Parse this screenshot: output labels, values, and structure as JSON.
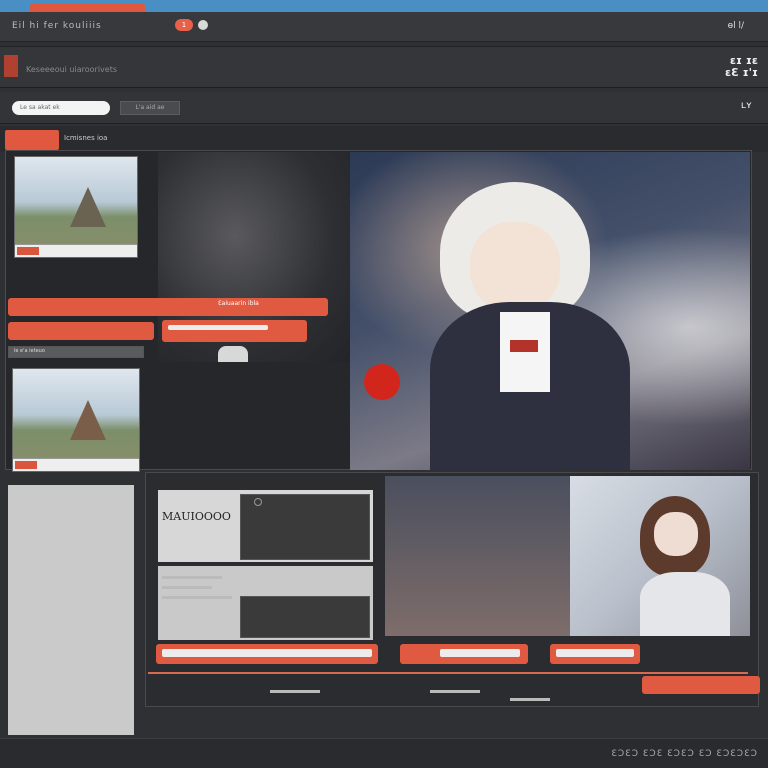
{
  "header": {
    "tab_title": "Eil hi fer kouliiis",
    "notification_count": "1",
    "top_right": "ɵl l/"
  },
  "subheader": {
    "subtitle": "Keseeeoui uiaroorivets",
    "right_label": "ɛɪ ɪɛ\nɛƐ ɪ'ɪ"
  },
  "toolbar": {
    "search_placeholder": "Le sa akat ek",
    "button_label": "L'a aid ae",
    "right_label": "ʟʏ"
  },
  "tabs": {
    "active_tab": "",
    "label": "Icmisnes ioa"
  },
  "sidebar": {
    "item1_caption": "",
    "item2_caption": "",
    "orange_banner": "Ɛaiuaarin ibla",
    "row_label": "le e'a ieteuo"
  },
  "lower": {
    "window_title": "MAUIOOOO",
    "search_text": "ɪ"
  },
  "footer": {
    "text": "ƐƆƐƆ ƐƆƐ ƐƆƐƆ ƐƆ ƐƆƐƆƐƆ"
  },
  "colors": {
    "accent": "#e0583f",
    "topstrip": "#4a8fc4",
    "bg": "#2f3033"
  }
}
